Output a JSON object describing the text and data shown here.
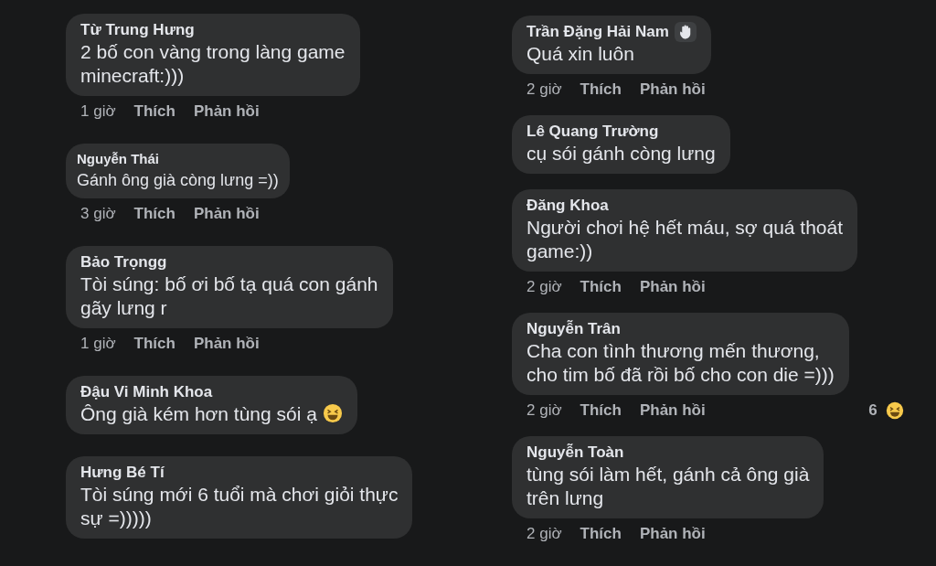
{
  "columns": [
    {
      "comments": [
        {
          "kind": "normal",
          "name": "Từ Trung Hưng",
          "lines": [
            "2 bố con vàng trong làng game",
            "minecraft:)))"
          ],
          "time": "1 giờ",
          "like": "Thích",
          "reply": "Phản hồi"
        },
        {
          "kind": "compact",
          "name": "Nguyễn Thái",
          "lines": [
            "Gánh ông già còng lưng =))"
          ],
          "time": "3 giờ",
          "like": "Thích",
          "reply": "Phản hồi"
        },
        {
          "kind": "normal",
          "name": "Bảo Trọngg",
          "lines": [
            "Tòi súng: bố ơi bố tạ quá con gánh",
            "gãy lưng r"
          ],
          "time": "1 giờ",
          "like": "Thích",
          "reply": "Phản hồi"
        },
        {
          "kind": "normal",
          "name": "Đậu Vi Minh Khoa",
          "lines": [
            "Ông già kém hơn tùng sói ạ"
          ],
          "text_emoji": {
            "kind": "laughing"
          }
        },
        {
          "kind": "normal",
          "name": "Hưng Bé Tí",
          "lines": [
            "Tòi súng mới 6 tuổi mà chơi giỏi thực",
            "sự =)))))"
          ]
        }
      ]
    },
    {
      "comments": [
        {
          "kind": "normal",
          "name": "Trần Đặng Hải Nam",
          "name_badge": {
            "kind": "wave"
          },
          "lines": [
            "Quá xin luôn"
          ],
          "time": "2 giờ",
          "like": "Thích",
          "reply": "Phản hồi"
        },
        {
          "kind": "normal",
          "name": "Lê Quang Trường",
          "lines": [
            "cụ sói gánh còng lưng"
          ]
        },
        {
          "kind": "normal",
          "name": "Đăng Khoa",
          "lines": [
            "Người chơi hệ hết máu, sợ quá thoát",
            "game:))"
          ],
          "time": "2 giờ",
          "like": "Thích",
          "reply": "Phản hồi"
        },
        {
          "kind": "normal",
          "name": "Nguyễn Trân",
          "lines": [
            "Cha con tình thương mến thương,",
            "cho tim bố đã rồi bố cho con die =)))"
          ],
          "time": "2 giờ",
          "like": "Thích",
          "reply": "Phản hồi",
          "reaction": {
            "count": "6",
            "kind": "laughing"
          }
        },
        {
          "kind": "normal",
          "name": "Nguyễn Toàn",
          "lines": [
            "tùng sói làm hết, gánh cả ông già",
            "trên lưng"
          ],
          "time": "2 giờ",
          "like": "Thích",
          "reply": "Phản hồi"
        }
      ]
    }
  ]
}
